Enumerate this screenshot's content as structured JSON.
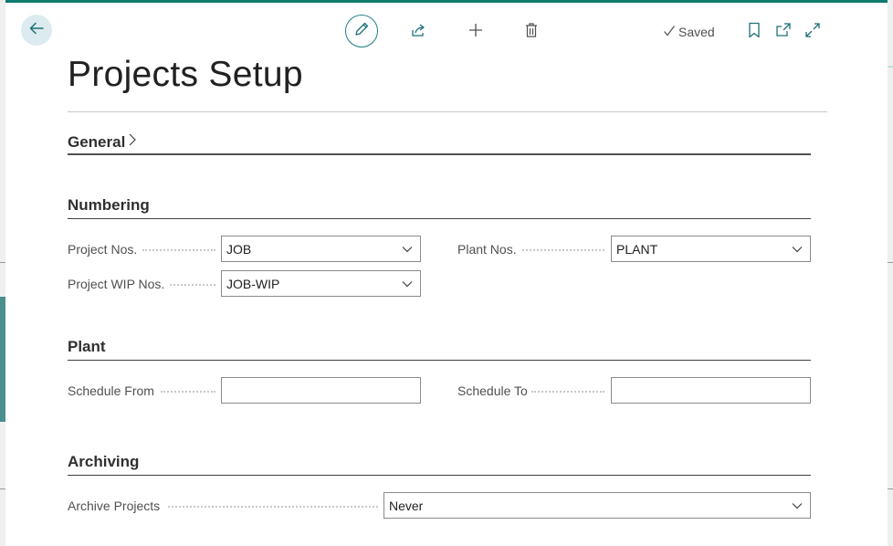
{
  "toolbar": {
    "saved_label": "Saved"
  },
  "page": {
    "title": "Projects Setup"
  },
  "sections": {
    "general": {
      "title": "General"
    },
    "numbering": {
      "title": "Numbering",
      "project_nos_label": "Project Nos.",
      "project_nos_value": "JOB",
      "project_wip_nos_label": "Project WIP Nos.",
      "project_wip_nos_value": "JOB-WIP",
      "plant_nos_label": "Plant Nos.",
      "plant_nos_value": "PLANT"
    },
    "plant": {
      "title": "Plant",
      "schedule_from_label": "Schedule From",
      "schedule_from_value": "",
      "schedule_to_label": "Schedule To",
      "schedule_to_value": ""
    },
    "archiving": {
      "title": "Archiving",
      "archive_projects_label": "Archive Projects",
      "archive_projects_value": "Never"
    }
  },
  "colors": {
    "accent": "#1f7f86",
    "back_button_bg": "#dcebef"
  },
  "icons": [
    "back-arrow-icon",
    "pencil-icon",
    "share-icon",
    "plus-icon",
    "trash-icon",
    "checkmark-icon",
    "bookmark-icon",
    "open-new-window-icon",
    "expand-icon",
    "chevron-right-icon",
    "chevron-down-icon"
  ]
}
